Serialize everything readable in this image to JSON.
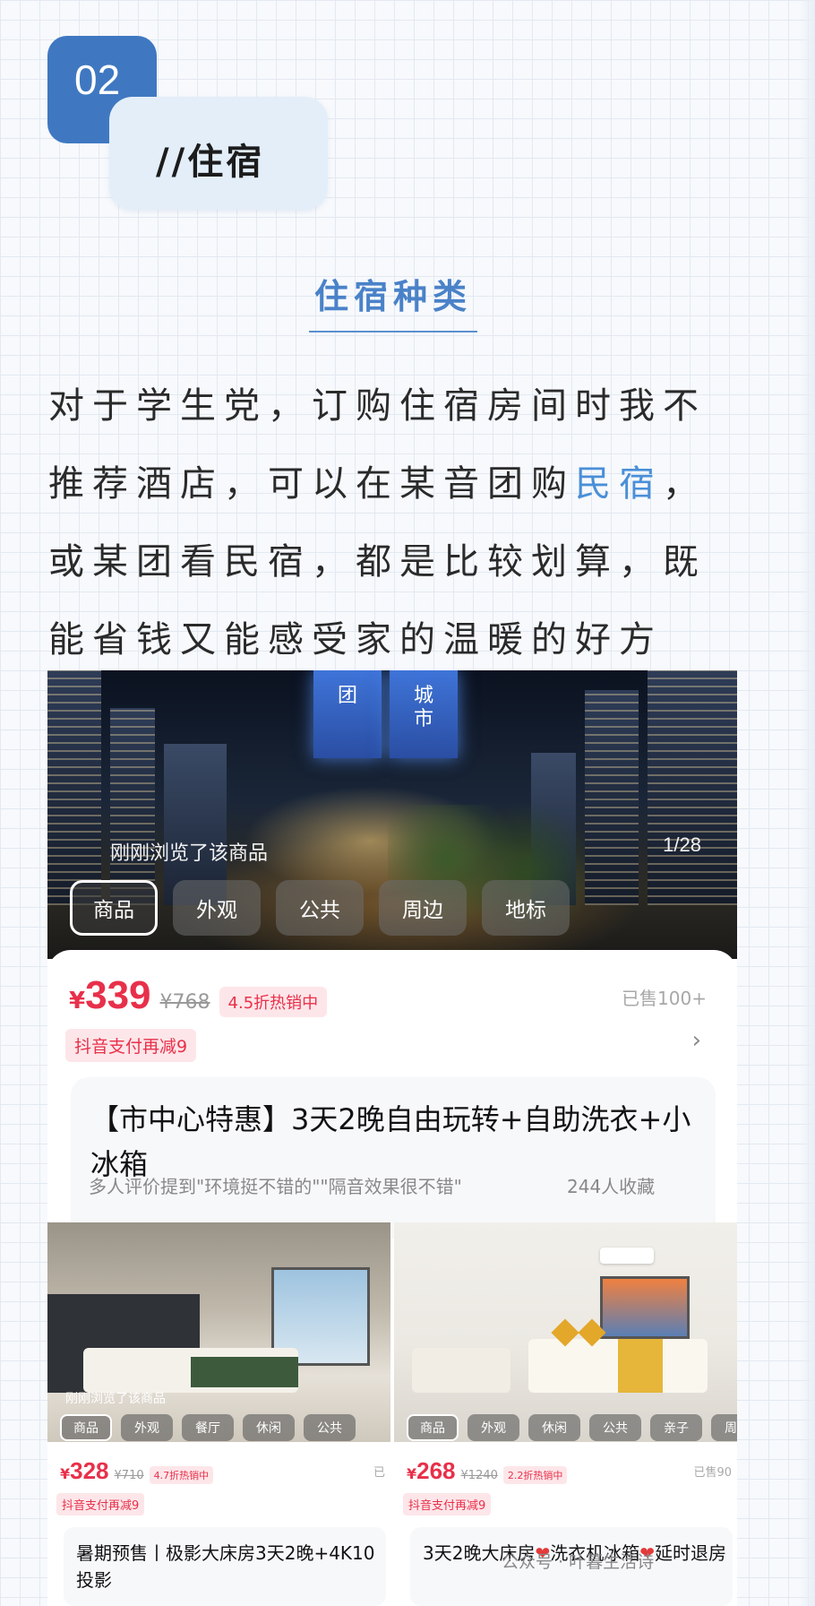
{
  "section": {
    "number": "02",
    "tag": "//住宿",
    "subheading": "住宿种类"
  },
  "paragraph": {
    "before": "对于学生党，订购住宿房间时我不推荐酒店，可以在某音团购",
    "highlight": "民宿",
    "after": "，或某团看民宿，都是比较划算，既能省钱又能感受家的温暖的好方式。"
  },
  "main_listing": {
    "towers": [
      "团",
      "城市"
    ],
    "recently_viewed": "刚刚浏览了该商品",
    "photo_counter": "1/28",
    "tabs": [
      {
        "label": "商品",
        "active": true
      },
      {
        "label": "外观",
        "active": false
      },
      {
        "label": "公共",
        "active": false
      },
      {
        "label": "周边",
        "active": false
      },
      {
        "label": "地标",
        "active": false
      }
    ],
    "currency": "¥",
    "price": "339",
    "original_price": "¥768",
    "discount_badge": "4.5折热销中",
    "sold": "已售100+",
    "pay_promo": "抖音支付再减9",
    "arrow": "›",
    "title": "【市中心特惠】3天2晚自由玩转+自助洗衣+小冰箱",
    "review_hint": "多人评价提到\"环境挺不错的\"\"隔音效果很不错\"",
    "favorites": "244人收藏"
  },
  "left_listing": {
    "recently_viewed": "刚刚浏览了该商品",
    "tabs": [
      "商品",
      "外观",
      "餐厅",
      "休闲",
      "公共"
    ],
    "currency": "¥",
    "price": "328",
    "original_price": "¥710",
    "discount_badge": "4.7折热销中",
    "sold": "已",
    "pay_promo": "抖音支付再减9",
    "title": "暑期预售丨极影大床房3天2晚+4K10投影"
  },
  "right_listing": {
    "tabs": [
      "商品",
      "外观",
      "休闲",
      "公共",
      "亲子",
      "周边"
    ],
    "currency": "¥",
    "price": "268",
    "original_price": "¥1240",
    "discount_badge": "2.2折热销中",
    "sold": "已售90",
    "pay_promo": "抖音支付再减9",
    "title_a": "3天2晚大床房",
    "title_b": "洗衣机冰箱",
    "title_c": "延时退房",
    "heart": "❤"
  },
  "watermark": "公众号 · 叶暮生活诗",
  "colors": {
    "accent_blue": "#3f78c1",
    "price_red": "#e8304a",
    "highlight": "#4a8fd8"
  }
}
